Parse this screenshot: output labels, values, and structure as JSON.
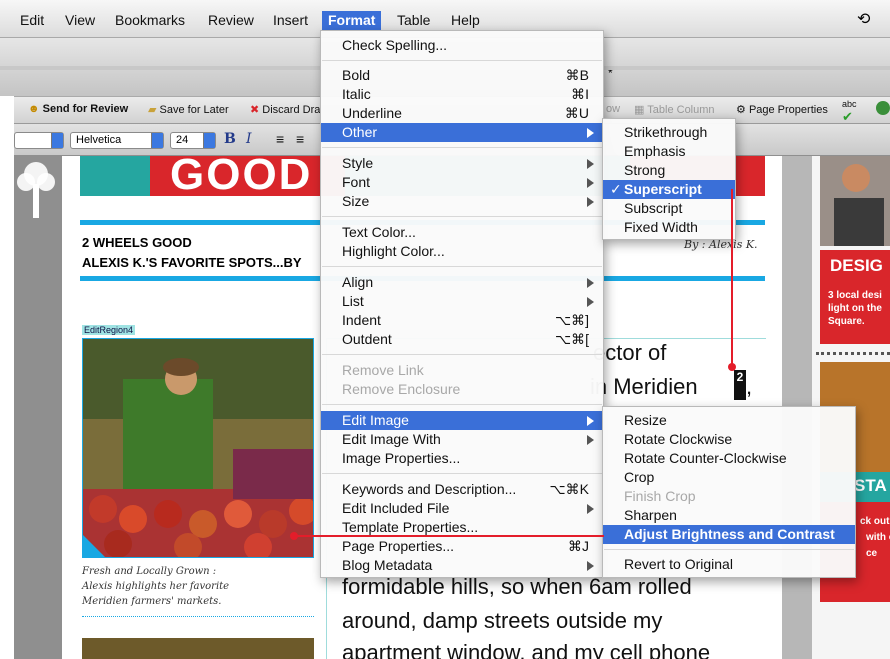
{
  "menubar": {
    "items": [
      "Edit",
      "View",
      "Bookmarks",
      "Review",
      "Insert",
      "Format",
      "Table",
      "Help"
    ],
    "active": "Format"
  },
  "titlebar": {
    "fragment": "*"
  },
  "toolbar": {
    "send_review": "Send for Review",
    "save_later": "Save for Later",
    "discard": "Discard Dra",
    "dim1": "ow",
    "table_column": "Table Column",
    "page_props": "Page Properties",
    "abc": "abc"
  },
  "formatbar": {
    "font": "Helvetica",
    "size": "24",
    "bold": "B",
    "italic": "I"
  },
  "page": {
    "banner_text": "GOOD",
    "heading1": "2 WHEELS GOOD",
    "heading2": "ALEXIS K.'S FAVORITE SPOTS...BY",
    "byline": "By : Alexis K.",
    "edit_region": "EditRegion4",
    "caption1": "Fresh and Locally Grown :",
    "caption2": "Alexis highlights her favorite",
    "caption3": "Meridien farmers' markets.",
    "body1": "ector of",
    "body2": "in Meridien",
    "superscript": "2",
    "body2b": ",",
    "body3": "formidable hills, so when 6am rolled",
    "body4": "around, damp streets outside my",
    "body5": "apartment window, and my cell phone"
  },
  "rightcol": {
    "desig": "DESIG",
    "desig_body1": "3 local desi",
    "desig_body2": "light on the",
    "desig_body3": "Square.",
    "sta": "STA",
    "sta_body1": "ck out t",
    "sta_body2": "with o",
    "sta_body3": "ce"
  },
  "format_menu": {
    "items": [
      {
        "label": "Check Spelling...",
        "shortcut": ""
      },
      {
        "label": "Bold",
        "shortcut": "⌘B"
      },
      {
        "label": "Italic",
        "shortcut": "⌘I"
      },
      {
        "label": "Underline",
        "shortcut": "⌘U"
      },
      {
        "label": "Other",
        "shortcut": ""
      },
      {
        "label": "Style",
        "shortcut": ""
      },
      {
        "label": "Font",
        "shortcut": ""
      },
      {
        "label": "Size",
        "shortcut": ""
      },
      {
        "label": "Text Color...",
        "shortcut": ""
      },
      {
        "label": "Highlight Color...",
        "shortcut": ""
      },
      {
        "label": "Align",
        "shortcut": ""
      },
      {
        "label": "List",
        "shortcut": ""
      },
      {
        "label": "Indent",
        "shortcut": "⌥⌘]"
      },
      {
        "label": "Outdent",
        "shortcut": "⌥⌘["
      },
      {
        "label": "Remove Link",
        "shortcut": ""
      },
      {
        "label": "Remove Enclosure",
        "shortcut": ""
      },
      {
        "label": "Edit Image",
        "shortcut": ""
      },
      {
        "label": "Edit Image With",
        "shortcut": ""
      },
      {
        "label": "Image Properties...",
        "shortcut": ""
      },
      {
        "label": "Keywords and Description...",
        "shortcut": "⌥⌘K"
      },
      {
        "label": "Edit Included File",
        "shortcut": ""
      },
      {
        "label": "Template Properties...",
        "shortcut": ""
      },
      {
        "label": "Page Properties...",
        "shortcut": "⌘J"
      },
      {
        "label": "Blog Metadata",
        "shortcut": ""
      }
    ]
  },
  "other_menu": {
    "items": [
      "Strikethrough",
      "Emphasis",
      "Strong",
      "Superscript",
      "Subscript",
      "Fixed Width"
    ],
    "checked": "✓"
  },
  "image_menu": {
    "items": [
      "Resize",
      "Rotate Clockwise",
      "Rotate Counter-Clockwise",
      "Crop",
      "Finish Crop",
      "Sharpen",
      "Adjust Brightness and Contrast",
      "Revert to Original"
    ]
  },
  "colors": {
    "highlight": "#3a6fd8",
    "accent_blue": "#19a8e3",
    "callout_red": "#e41d2a",
    "banner_red": "#d9262b"
  }
}
